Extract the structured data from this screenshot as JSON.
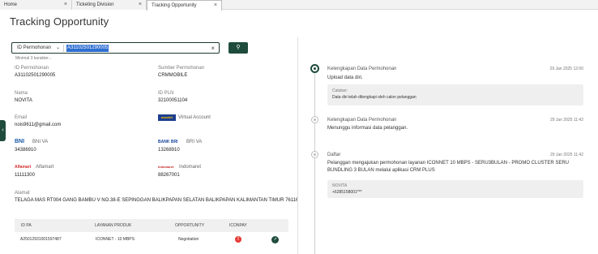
{
  "tabs": [
    {
      "label": "Home",
      "close": "×"
    },
    {
      "label": "Ticketing Division",
      "close": "×"
    },
    {
      "label": "Tracking Opportunity",
      "close": "×"
    }
  ],
  "page": {
    "title": "Tracking Opportunity"
  },
  "search": {
    "type_label": "ID Permohonan",
    "value": "A31102501290005",
    "hint": "Minimal 3 karakter...",
    "clear_glyph": "×",
    "button_glyph": "⚲"
  },
  "details": {
    "id_permohonan": {
      "label": "ID Permohonan",
      "value": "A31102501290005"
    },
    "sumber": {
      "label": "Sumber Permohonan",
      "value": "CRMMOBILE"
    },
    "nama": {
      "label": "Nama",
      "value": "NOVITA"
    },
    "id_pln": {
      "label": "ID PLN",
      "value": "32100051104"
    },
    "email": {
      "label": "Email",
      "value": "nois9611@gmail.com"
    },
    "alamat": {
      "label": "Alamat",
      "value": "TELAGA MAS RT004 GANG BAMBU V NO.38-E SEPINGGAN BALIKPAPAN SELATAN BALIKPAPAN KALIMANTAN TIMUR 76116"
    }
  },
  "payments": {
    "virtual_account": {
      "logo": "mandiri",
      "name": "Virtual Account"
    },
    "bni": {
      "logo": "BNI",
      "name": "BNI VA",
      "value": "34386910"
    },
    "bri": {
      "logo": "BANK BRI",
      "name": "BRI VA",
      "value": "13268910"
    },
    "alfamart": {
      "logo": "Alfamart",
      "name": "Alfamart",
      "value": "11111300"
    },
    "indomaret": {
      "logo": "Indomaret",
      "name": "Indomaret",
      "value": "88267001"
    }
  },
  "table": {
    "headers": [
      "ID PA",
      "LAYANAN PRODUK",
      "OPPORTUNITY",
      "ICONPAY"
    ],
    "row": {
      "id_pa": "A25012931001597487",
      "layanan": "ICONNET - 10 MBPS",
      "opportunity": "Negotiation",
      "iconpay_glyph": "!",
      "trend_glyph": "↗"
    }
  },
  "timeline": [
    {
      "title": "Kelengkapan Data Permohonan",
      "date": "29 Jan 2025 12:00",
      "text": "Upload data diri.",
      "note_label": "Catatan:",
      "note_value": "Data diri telah dilengkapi oleh calon pelanggan"
    },
    {
      "title": "Kelengkapan Data Permohonan",
      "date": "29 Jan 2025 11:42",
      "text": "Menunggu informasi data pelanggan."
    },
    {
      "title": "Daftar",
      "date": "29 Jan 2025 11:42",
      "text": "Pelanggan mengajukan permohonan layanan ICONNET 10 MBPS - SERU3BULAN - PROMO CLUSTER SERU BUNDLING 3 BULAN melalui aplikasi CRM PLUS",
      "note_label": "NOVITA",
      "note_value": "+6285158001***"
    }
  ],
  "colors": {
    "primary": "#1f4b3d",
    "selection": "#2f6fd1",
    "alert": "#e53935"
  }
}
